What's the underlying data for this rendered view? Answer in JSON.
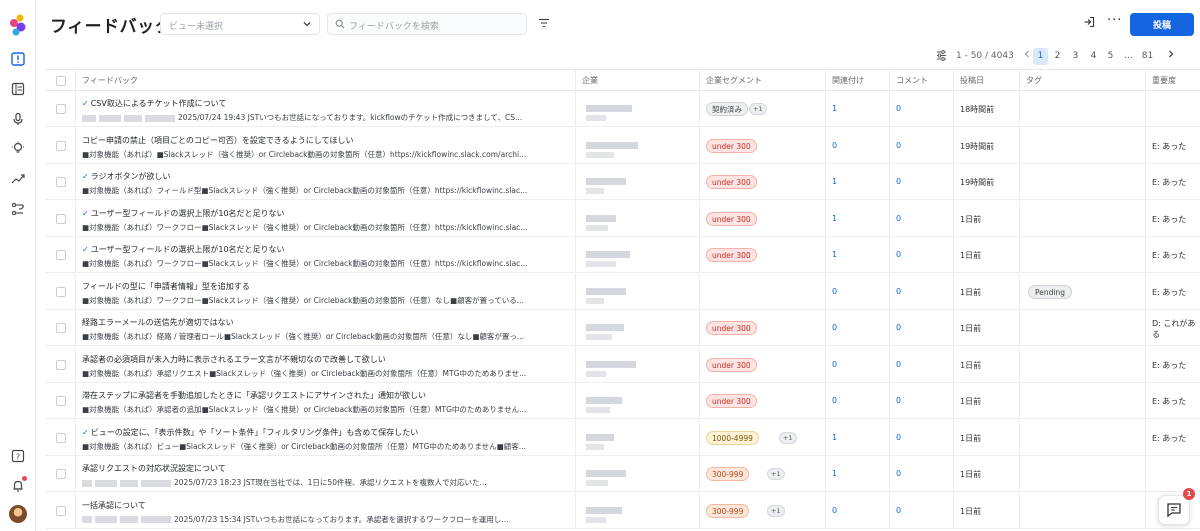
{
  "header": {
    "title": "フィードバック",
    "view_placeholder": "ビュー未選択",
    "search_placeholder": "フィードバックを検索",
    "post_label": "投稿",
    "more_label": "···"
  },
  "pagination": {
    "range": "1 - 50 / 4043",
    "pages": [
      "1",
      "2",
      "3",
      "4",
      "5",
      "...",
      "81"
    ],
    "active": "1"
  },
  "columns": [
    "フィードバック",
    "企業",
    "企業セグメント",
    "関連付け",
    "コメント",
    "投稿日",
    "タグ",
    "重要度"
  ],
  "rows": [
    {
      "checked": true,
      "title": "CSV取込によるチケット作成について",
      "desc": "2025/07/24 19:43 JSTいつもお世話になっております。kickflowのチケット作成につきまして、CS...",
      "segment": "契約済み",
      "segment_color": "gray",
      "plus": "+1",
      "links": "1",
      "comments": "0",
      "date": "18時間前",
      "tag": "",
      "importance": ""
    },
    {
      "checked": false,
      "title": "コピー申請の禁止（項目ごとのコピー可否）を設定できるようにしてほしい",
      "desc": "■対象機能（あれば）■Slackスレッド（強く推奨）or Circleback動画の対象箇所（任意）https://kickflowinc.slack.com/archi...",
      "segment": "under 300",
      "segment_color": "red",
      "plus": "",
      "links": "0",
      "comments": "0",
      "date": "19時間前",
      "tag": "",
      "importance": "E: あった"
    },
    {
      "checked": true,
      "title": "ラジオボタンが欲しい",
      "desc": "■対象機能（あれば）フィールド型■Slackスレッド（強く推奨）or Circleback動画の対象箇所（任意）https://kickflowinc.slac...",
      "segment": "under 300",
      "segment_color": "red",
      "plus": "",
      "links": "1",
      "comments": "0",
      "date": "19時間前",
      "tag": "",
      "importance": "E: あった"
    },
    {
      "checked": true,
      "title": "ユーザー型フィールドの選択上限が10名だと足りない",
      "desc": "■対象機能（あれば）ワークフロー■Slackスレッド（強く推奨）or Circleback動画の対象箇所（任意）https://kickflowinc.slac...",
      "segment": "under 300",
      "segment_color": "red",
      "plus": "",
      "links": "1",
      "comments": "0",
      "date": "1日前",
      "tag": "",
      "importance": "E: あった"
    },
    {
      "checked": true,
      "title": "ユーザー型フィールドの選択上限が10名だと足りない",
      "desc": "■対象機能（あれば）ワークフロー■Slackスレッド（強く推奨）or Circleback動画の対象箇所（任意）https://kickflowinc.slac...",
      "segment": "under 300",
      "segment_color": "red",
      "plus": "",
      "links": "1",
      "comments": "0",
      "date": "1日前",
      "tag": "",
      "importance": "E: あった"
    },
    {
      "checked": false,
      "title": "フィールドの型に「申請者情報」型を追加する",
      "desc": "■対象機能（あれば）ワークフロー■Slackスレッド（強く推奨）or Circleback動画の対象箇所（任意）なし■顧客が置っている...",
      "segment": "",
      "segment_color": "",
      "plus": "",
      "links": "0",
      "comments": "0",
      "date": "1日前",
      "tag": "Pending",
      "importance": "E: あった"
    },
    {
      "checked": false,
      "title": "経路エラーメールの送信先が適切ではない",
      "desc": "■対象機能（あれば）経路 / 管理者ロール■Slackスレッド（強く推奨）or Circleback動画の対象箇所（任意）なし■顧客が置っ...",
      "segment": "under 300",
      "segment_color": "red",
      "plus": "",
      "links": "0",
      "comments": "0",
      "date": "1日前",
      "tag": "",
      "importance": "D: これがある"
    },
    {
      "checked": false,
      "title": "承認者の必須項目が未入力時に表示されるエラー文言が不親切なので改善して欲しい",
      "desc": "■対象機能（あれば）承認リクエスト■Slackスレッド（強く推奨）or Circleback動画の対象箇所（任意）MTG中のためありませ...",
      "segment": "under 300",
      "segment_color": "red",
      "plus": "",
      "links": "0",
      "comments": "0",
      "date": "1日前",
      "tag": "",
      "importance": "E: あった"
    },
    {
      "checked": false,
      "title": "滞在ステップに承認者を手動追加したときに「承認リクエストにアサインされた」通知が欲しい",
      "desc": "■対象機能（あれば）承認者の追加■Slackスレッド（強く推奨）or Circleback動画の対象箇所（任意）MTG中のためありません...",
      "segment": "under 300",
      "segment_color": "red",
      "plus": "",
      "links": "0",
      "comments": "0",
      "date": "1日前",
      "tag": "",
      "importance": "E: あった"
    },
    {
      "checked": true,
      "title": "ビューの設定に、「表示件数」や「ソート条件」「フィルタリング条件」も含めて保存したい",
      "desc": "■対象機能（あれば）ビュー■Slackスレッド（強く推奨）or Circleback動画の対象箇所（任意）MTG中のためありません■顧客...",
      "segment": "1000-4999",
      "segment_color": "yellow",
      "plus": "+1",
      "links": "1",
      "comments": "0",
      "date": "1日前",
      "tag": "",
      "importance": "E: あった"
    },
    {
      "checked": false,
      "title": "承認リクエストの対応状況設定について",
      "desc": "2025/07/23 18:23 JST現在当社では、1日に50件程、承認リクエストを複数人で対応いた...",
      "segment": "300-999",
      "segment_color": "orange",
      "plus": "+1",
      "links": "1",
      "comments": "0",
      "date": "1日前",
      "tag": "",
      "importance": ""
    },
    {
      "checked": false,
      "title": "一括承認について",
      "desc": "2025/07/23 15:34 JSTいつもお世話になっております。承認者を選択するワークフローを運用し...",
      "segment": "300-999",
      "segment_color": "orange",
      "plus": "+1",
      "links": "0",
      "comments": "0",
      "date": "1日前",
      "tag": "",
      "importance": ""
    }
  ],
  "chat": {
    "badge": "1"
  },
  "colors": {
    "accent": "#1565e0",
    "badge_red": "#e5484d"
  }
}
